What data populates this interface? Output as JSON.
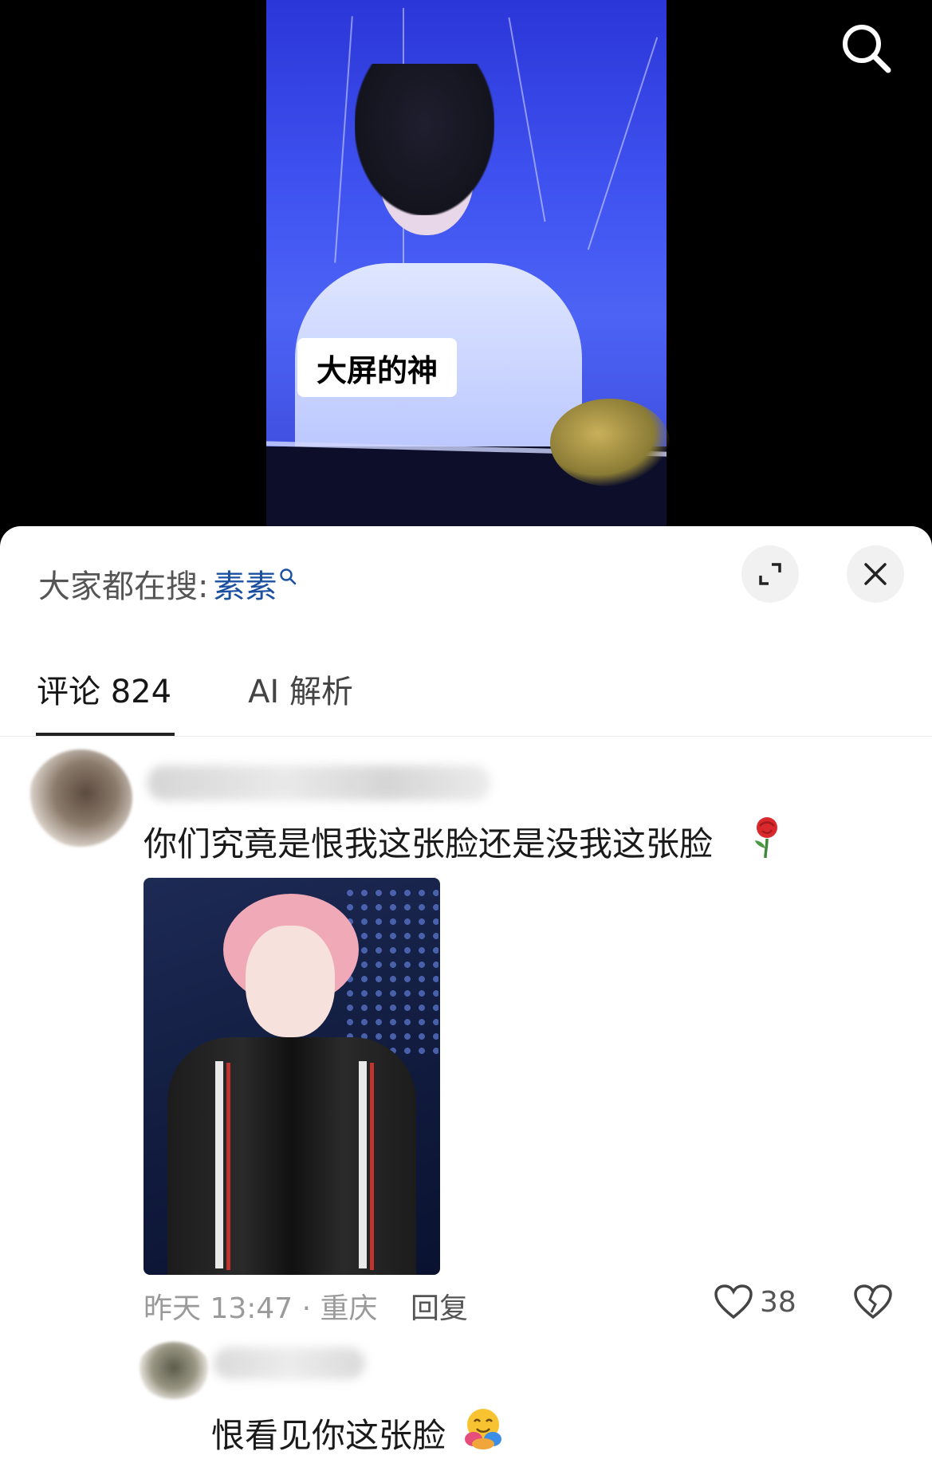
{
  "video": {
    "caption": "大屏的神"
  },
  "sheet": {
    "trending_prefix": "大家都在搜:",
    "trending_keyword": "素素",
    "tabs": [
      {
        "label": "评论 824",
        "active": true
      },
      {
        "label": "AI 解析",
        "active": false
      }
    ]
  },
  "comment": {
    "text": "你们究竟是恨我这张脸还是没我这张脸",
    "meta": "昨天 13:47 · 重庆",
    "reply_label": "回复",
    "like_count": "38"
  },
  "reply": {
    "text": "恨看见你这张脸"
  },
  "colors": {
    "accent_keyword": "#1b4fa0",
    "tab_underline": "#222222",
    "sheet_bg": "#ffffff"
  },
  "icons": [
    "search-icon",
    "mini-search-icon",
    "expand-icon",
    "close-icon",
    "rose-emoji",
    "heart-icon",
    "dislike-icon",
    "hug-emoji"
  ]
}
